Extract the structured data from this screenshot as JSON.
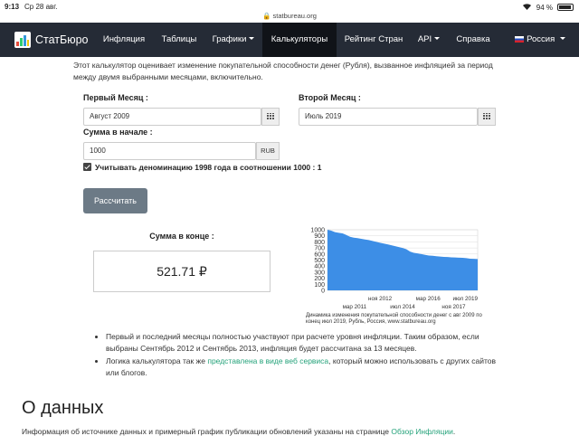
{
  "status": {
    "time": "9:13",
    "date": "Ср 28 авг.",
    "url": "statbureau.org",
    "battery": "94 %",
    "battery_level": 94
  },
  "nav": {
    "brand": "СтатБюро",
    "items": [
      "Инфляция",
      "Таблицы",
      "Графики",
      "Калькуляторы",
      "Рейтинг Стран",
      "API",
      "Справка"
    ],
    "lang": "Россия"
  },
  "intro": "Этот калькулятор оценивает изменение покупательной способности денег (Рубля), вызванное инфляцией за период между двумя выбранными месяцами, включительно.",
  "form": {
    "first_label": "Первый Месяц :",
    "first_value": "Август 2009",
    "second_label": "Второй Месяц :",
    "second_value": "Июль 2019",
    "amount_label": "Сумма в начале :",
    "amount_value": "1000",
    "currency": "RUB",
    "denom_label": "Учитывать деноминацию 1998 года в соотношении 1000 : 1",
    "calc_button": "Рассчитать"
  },
  "result": {
    "title": "Сумма в конце :",
    "value": "521.71 ₽"
  },
  "chart_data": {
    "type": "area",
    "x": [
      "2009-08",
      "2009-11",
      "2010-02",
      "2010-05",
      "2010-08",
      "2010-11",
      "2011-02",
      "2011-05",
      "2011-08",
      "2011-11",
      "2012-02",
      "2012-05",
      "2012-08",
      "2012-11",
      "2013-02",
      "2013-05",
      "2013-08",
      "2013-11",
      "2014-02",
      "2014-05",
      "2014-08",
      "2014-11",
      "2015-02",
      "2015-05",
      "2015-08",
      "2015-11",
      "2016-02",
      "2016-05",
      "2016-08",
      "2016-11",
      "2017-02",
      "2017-05",
      "2017-08",
      "2017-11",
      "2018-02",
      "2018-05",
      "2018-08",
      "2018-11",
      "2019-02",
      "2019-05",
      "2019-07"
    ],
    "values": [
      1000,
      985,
      960,
      950,
      940,
      915,
      885,
      870,
      862,
      850,
      840,
      830,
      815,
      800,
      785,
      772,
      760,
      745,
      730,
      715,
      700,
      680,
      640,
      620,
      610,
      598,
      585,
      575,
      570,
      563,
      557,
      552,
      550,
      545,
      543,
      540,
      537,
      532,
      523,
      520,
      517
    ],
    "ylim": [
      0,
      1000
    ],
    "yticks": [
      0,
      100,
      200,
      300,
      400,
      500,
      600,
      700,
      800,
      900,
      1000
    ],
    "xticks_upper": [
      "ноя 2012",
      "мар 2016",
      "июл 2019"
    ],
    "xticks_lower": [
      "мар 2011",
      "июл 2014",
      "ноя 2017"
    ],
    "grid": true,
    "color": "#3d8ee6",
    "caption": "Динамика изменения покупательной способности денег с авг 2009 по конец июл 2019, Рубль, Россия, www.statbureau.org"
  },
  "bullets": {
    "b1": "Первый и последний месяцы полностью участвуют при расчете уровня инфляции. Таким образом, если выбраны Сентябрь 2012 и Сентябрь 2013, инфляция будет рассчитана за 13 месяцев.",
    "b2_pre": "Логика калькулятора так же ",
    "b2_link": "представлена в виде веб сервиса",
    "b2_post": ", который можно использовать с других сайтов или блогов."
  },
  "about": {
    "title": "О данных",
    "text_pre": "Информация об источнике данных и примерный график публикации обновлений указаны на странице ",
    "link": "Обзор Инфляции",
    "text_post": "."
  }
}
